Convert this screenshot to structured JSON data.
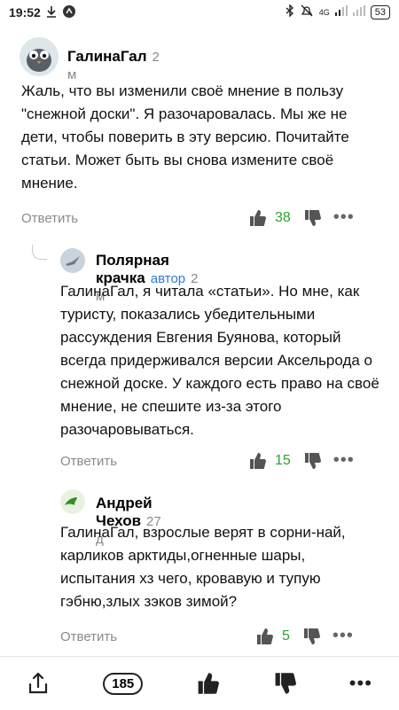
{
  "statusbar": {
    "time": "19:52",
    "network": "4G",
    "battery": "53"
  },
  "comments": [
    {
      "author": "ГалинаГал",
      "time": "2 м",
      "text": "Жаль, что вы изменили своё мнение в пользу \"снежной доски\". Я разочаровалась. Мы же не дети, чтобы поверить в эту версию. Почитайте статьи. Может быть вы снова измените своё мнение.",
      "reply_label": "Ответить",
      "likes": "38"
    },
    {
      "author": "Полярная крачка",
      "badge": "автор",
      "time": "2 м",
      "text": "ГалинаГал, я читала «статьи». Но мне, как туристу, показались убедительными рассуждения Евгения Буянова, который всегда придерживался версии Аксельрода о снежной доске. У каждого есть право на своё мнение, не спешите из-за этого разочаровываться.",
      "reply_label": "Ответить",
      "likes": "15"
    },
    {
      "author": "Андрей Чехов",
      "time": "27 д",
      "text": "ГалинаГал, взрослые верят в сорни-най, карликов арктиды,огненные шары, испытания хз чего, кровавую и тупую гэбню,злых зэков зимой?",
      "reply_label": "Ответить",
      "likes": "5"
    }
  ],
  "bottombar": {
    "comments_count": "185"
  },
  "colors": {
    "likes_green": "#2aa52a",
    "author_badge_blue": "#2e7bd6",
    "muted_gray": "#8a8a8a"
  }
}
